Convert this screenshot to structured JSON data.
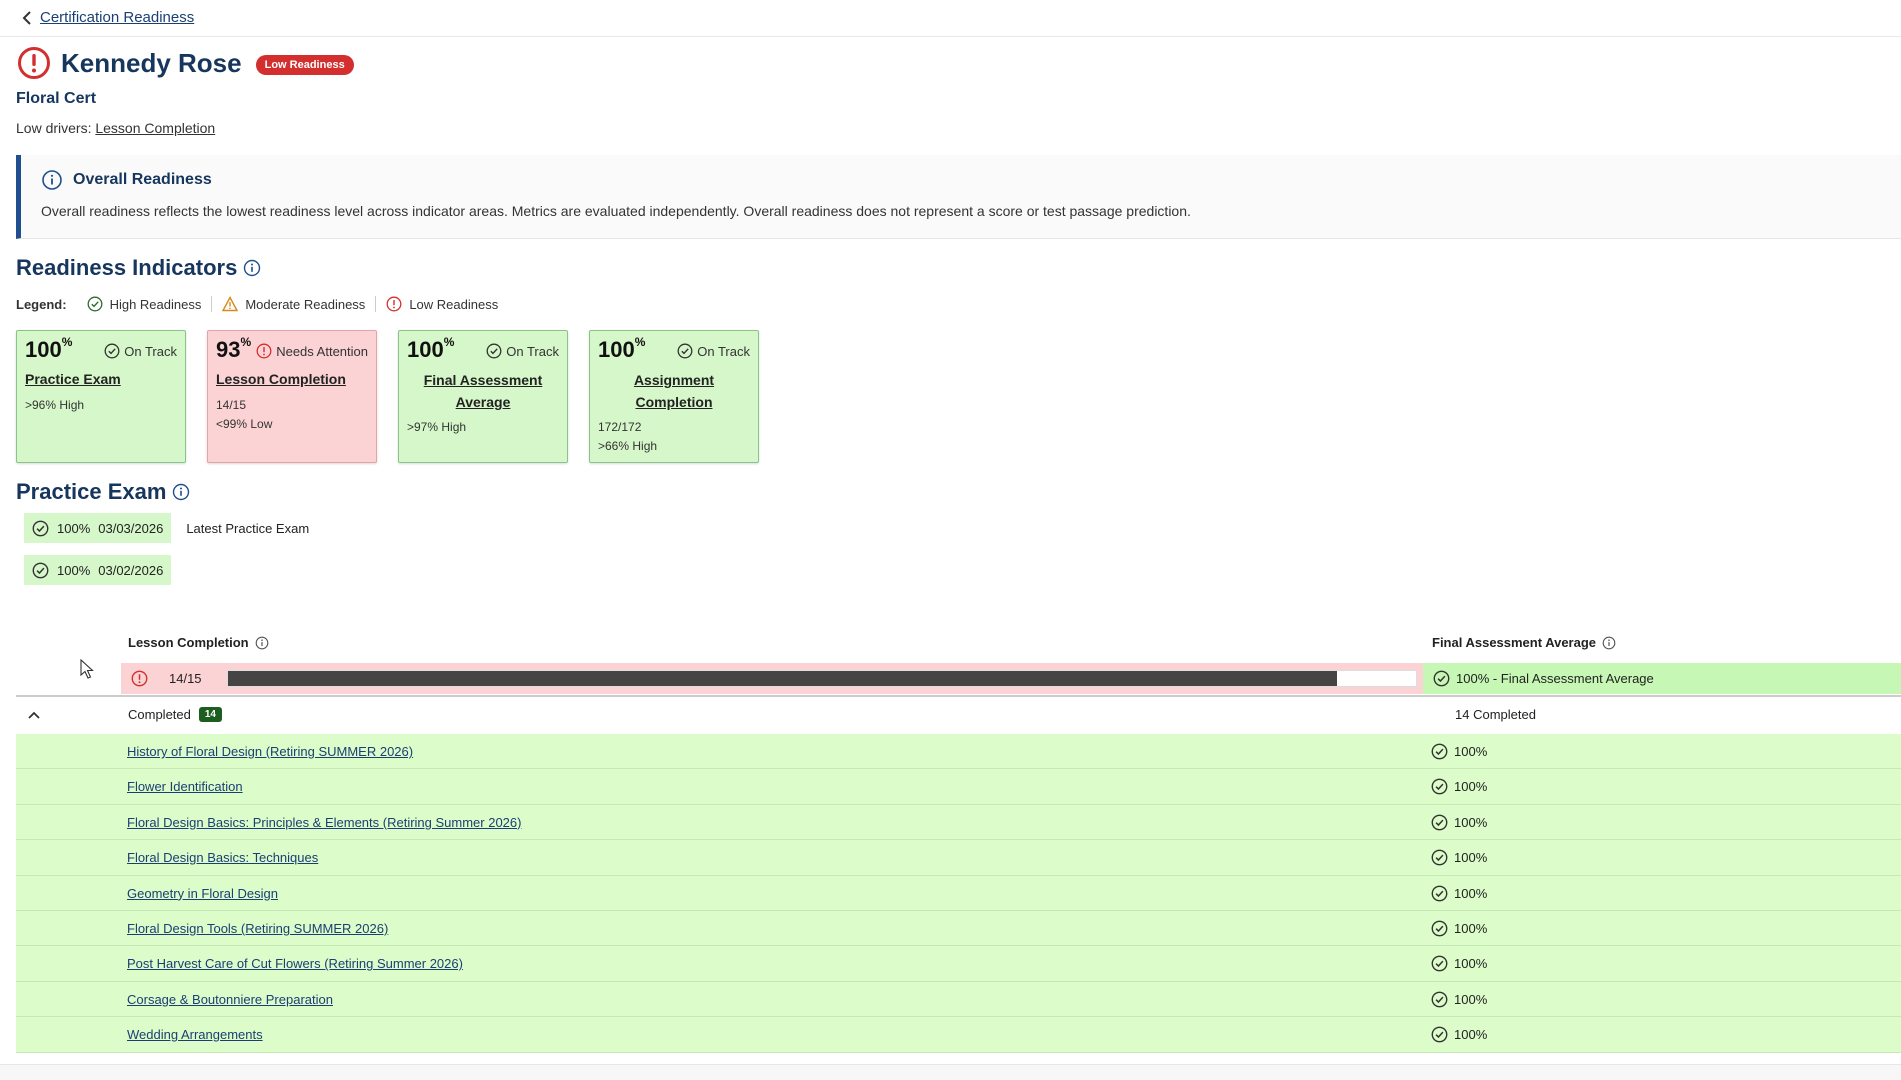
{
  "breadcrumb": {
    "back_label": "Certification Readiness"
  },
  "student": {
    "name": "Kennedy Rose",
    "badge": "Low Readiness",
    "program": "Floral Cert"
  },
  "drivers": {
    "prefix": "Low drivers:",
    "link": "Lesson Completion"
  },
  "overall": {
    "title": "Overall Readiness",
    "text": "Overall readiness reflects the lowest readiness level across indicator areas. Metrics are evaluated independently. Overall readiness does not represent a score or test passage prediction."
  },
  "indicators": {
    "title": "Readiness Indicators"
  },
  "legend": {
    "label": "Legend:",
    "items": [
      "High Readiness",
      "Moderate Readiness",
      "Low Readiness"
    ]
  },
  "cards": [
    {
      "value": "100",
      "unit": "%",
      "status": "On Track",
      "title": "Practice Exam",
      "meta1": ">96% High",
      "meta2": ""
    },
    {
      "value": "93",
      "unit": "%",
      "status": "Needs Attention",
      "title": "Lesson Completion",
      "meta1": "14/15",
      "meta2": "<99% Low"
    },
    {
      "value": "100",
      "unit": "%",
      "status": "On Track",
      "title": "Final Assessment Average",
      "meta1": ">97% High",
      "meta2": ""
    },
    {
      "value": "100",
      "unit": "%",
      "status": "On Track",
      "title": "Assignment Completion",
      "meta1": "172/172",
      "meta2": ">66% High"
    }
  ],
  "practice_exam": {
    "title": "Practice Exam",
    "exams": [
      {
        "score": "100%",
        "date": "03/03/2026",
        "note": "Latest Practice Exam"
      },
      {
        "score": "100%",
        "date": "03/02/2026",
        "note": ""
      }
    ]
  },
  "table": {
    "col_lesson": "Lesson Completion",
    "col_final": "Final Assessment Average",
    "progress": {
      "count": "14/15",
      "completed": 14,
      "total": 15,
      "final_text": "100% - Final Assessment Average"
    },
    "completed_label": "Completed",
    "completed_badge": "14",
    "completed_count": "14 Completed",
    "lessons": [
      {
        "name": "History of Floral Design (Retiring SUMMER 2026)",
        "score": "100%"
      },
      {
        "name": "Flower Identification",
        "score": "100%"
      },
      {
        "name": "Floral Design Basics: Principles & Elements (Retiring Summer 2026)",
        "score": "100%"
      },
      {
        "name": "Floral Design Basics: Techniques",
        "score": "100%"
      },
      {
        "name": "Geometry in Floral Design",
        "score": "100%"
      },
      {
        "name": "Floral Design Tools (Retiring SUMMER 2026)",
        "score": "100%"
      },
      {
        "name": "Post Harvest Care of Cut Flowers (Retiring Summer 2026)",
        "score": "100%"
      },
      {
        "name": "Corsage & Boutonniere Preparation",
        "score": "100%"
      },
      {
        "name": "Wedding Arrangements",
        "score": "100%"
      }
    ]
  },
  "colors": {
    "navy": "#17365d",
    "high": "#d6f7c9",
    "low": "#fbd3d4",
    "badge_red": "#d32f2f",
    "completed_badge": "#1b5e20"
  }
}
